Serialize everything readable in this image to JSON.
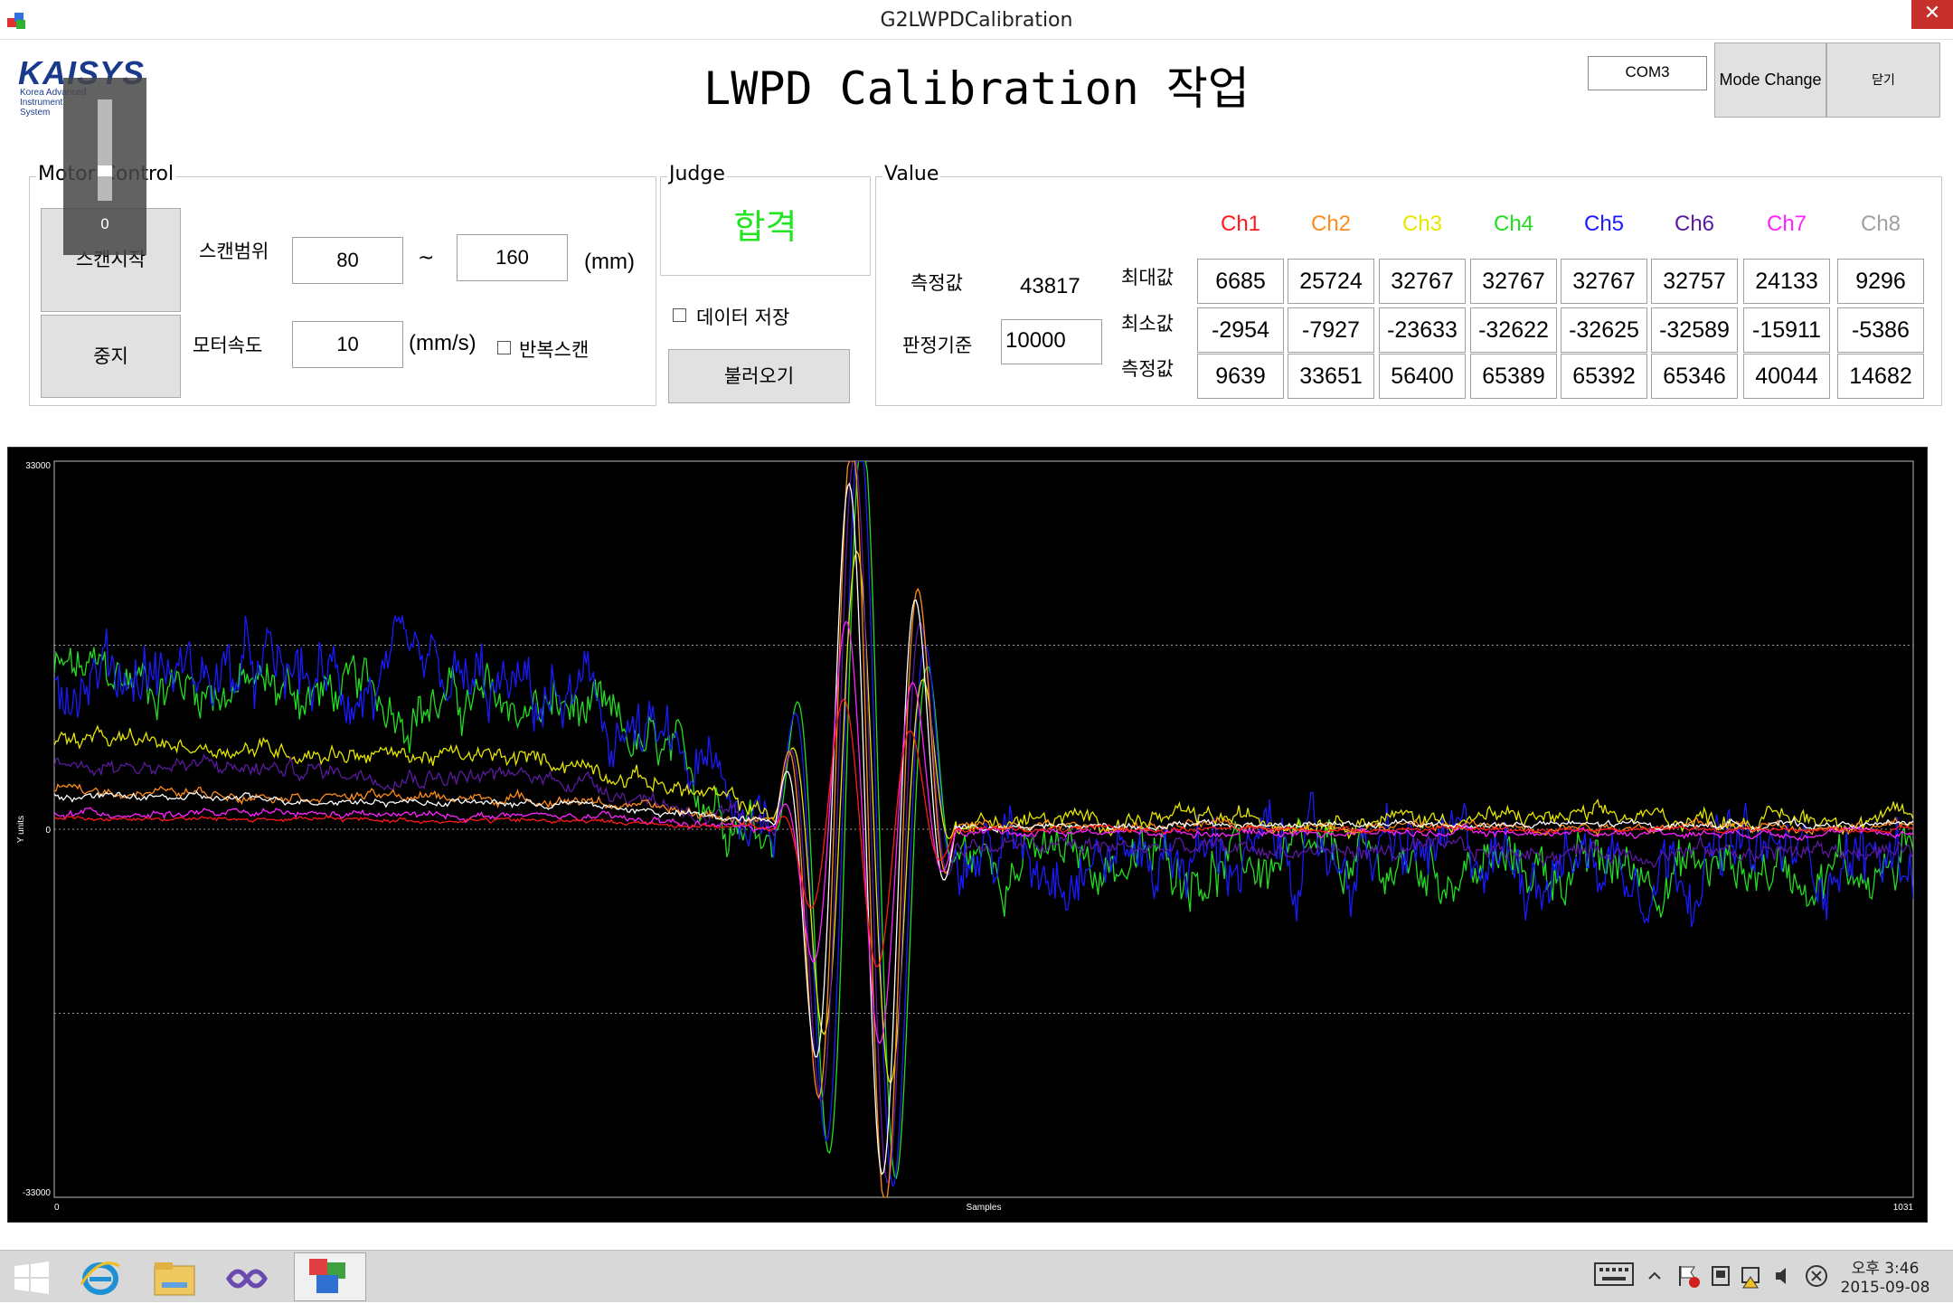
{
  "window": {
    "title": "G2LWPDCalibration",
    "close_glyph": "✕"
  },
  "header": {
    "logo_text": "KAISYS",
    "logo_sub_1": "Korea Advanced",
    "logo_sub_2": "Instrument",
    "logo_sub_3": "System",
    "page_title": "LWPD Calibration 작업",
    "com_port": "COM3",
    "mode_change_label": "Mode Change",
    "close_label": "닫기"
  },
  "progress": {
    "value": "0",
    "level": 0.3
  },
  "motor": {
    "group_label": "Motor Control",
    "start_label": "스캔시작",
    "stop_label": "중지",
    "scan_range_label": "스캔범위",
    "scan_from": "80",
    "tilde": "~",
    "scan_to": "160",
    "range_unit": "(mm)",
    "speed_label": "모터속도",
    "speed": "10",
    "speed_unit": "(mm/s)",
    "repeat_label": "반복스캔",
    "repeat_checked": false
  },
  "judge": {
    "group_label": "Judge",
    "result": "합격",
    "save_label": "데이터 저장",
    "save_checked": false,
    "load_label": "불러오기"
  },
  "value": {
    "group_label": "Value",
    "measure_label": "측정값",
    "measure_value": "43817",
    "criteria_label": "판정기준",
    "criteria_value": "10000",
    "row_labels": {
      "max": "최대값",
      "min": "최소값",
      "measure": "측정값"
    },
    "channels": [
      {
        "name": "Ch1",
        "color": "#ff1a1a",
        "max": "6685",
        "min": "-2954",
        "measure": "9639"
      },
      {
        "name": "Ch2",
        "color": "#ff8c1a",
        "max": "25724",
        "min": "-7927",
        "measure": "33651"
      },
      {
        "name": "Ch3",
        "color": "#e6e600",
        "max": "32767",
        "min": "-23633",
        "measure": "56400"
      },
      {
        "name": "Ch4",
        "color": "#22dd22",
        "max": "32767",
        "min": "-32622",
        "measure": "65389"
      },
      {
        "name": "Ch5",
        "color": "#1a1aff",
        "max": "32767",
        "min": "-32625",
        "measure": "65392"
      },
      {
        "name": "Ch6",
        "color": "#5a1aa0",
        "max": "32757",
        "min": "-32589",
        "measure": "65346"
      },
      {
        "name": "Ch7",
        "color": "#ff22ff",
        "max": "24133",
        "min": "-15911",
        "measure": "40044"
      },
      {
        "name": "Ch8",
        "color": "#a0a0a0",
        "max": "9296",
        "min": "-5386",
        "measure": "14682"
      }
    ]
  },
  "chart_data": {
    "type": "line",
    "xlabel": "Samples",
    "ylabel": "Y units",
    "xlim": [
      0,
      1031
    ],
    "ylim": [
      -33000,
      33000
    ],
    "x_tick_labels": [
      "0",
      "1031"
    ],
    "y_tick_labels": [
      "33000",
      "0",
      "-33000"
    ],
    "grid": "dotted at ±16500 and 0",
    "background": "#000000",
    "series": [
      {
        "color": "#22dd22",
        "baseline_start": 14000,
        "baseline_end": -3500,
        "noise": 4500
      },
      {
        "color": "#1a1aff",
        "baseline_start": 15000,
        "baseline_end": -2500,
        "noise": 6000
      },
      {
        "color": "#e6e600",
        "baseline_start": 8000,
        "baseline_end": 1000,
        "noise": 1500
      },
      {
        "color": "#5a1aa0",
        "baseline_start": 6000,
        "baseline_end": -2000,
        "noise": 1500
      },
      {
        "color": "#ff8c1a",
        "baseline_start": 3500,
        "baseline_end": 300,
        "noise": 800
      },
      {
        "color": "#ffffff",
        "baseline_start": 3000,
        "baseline_end": 400,
        "noise": 600
      },
      {
        "color": "#ff22ff",
        "baseline_start": 1500,
        "baseline_end": -300,
        "noise": 600
      },
      {
        "color": "#ff1a1a",
        "baseline_start": 1000,
        "baseline_end": 0,
        "noise": 400
      }
    ],
    "peak_region": [
      400,
      500
    ]
  },
  "taskbar": {
    "time": "오후 3:46",
    "date": "2015-09-08"
  }
}
